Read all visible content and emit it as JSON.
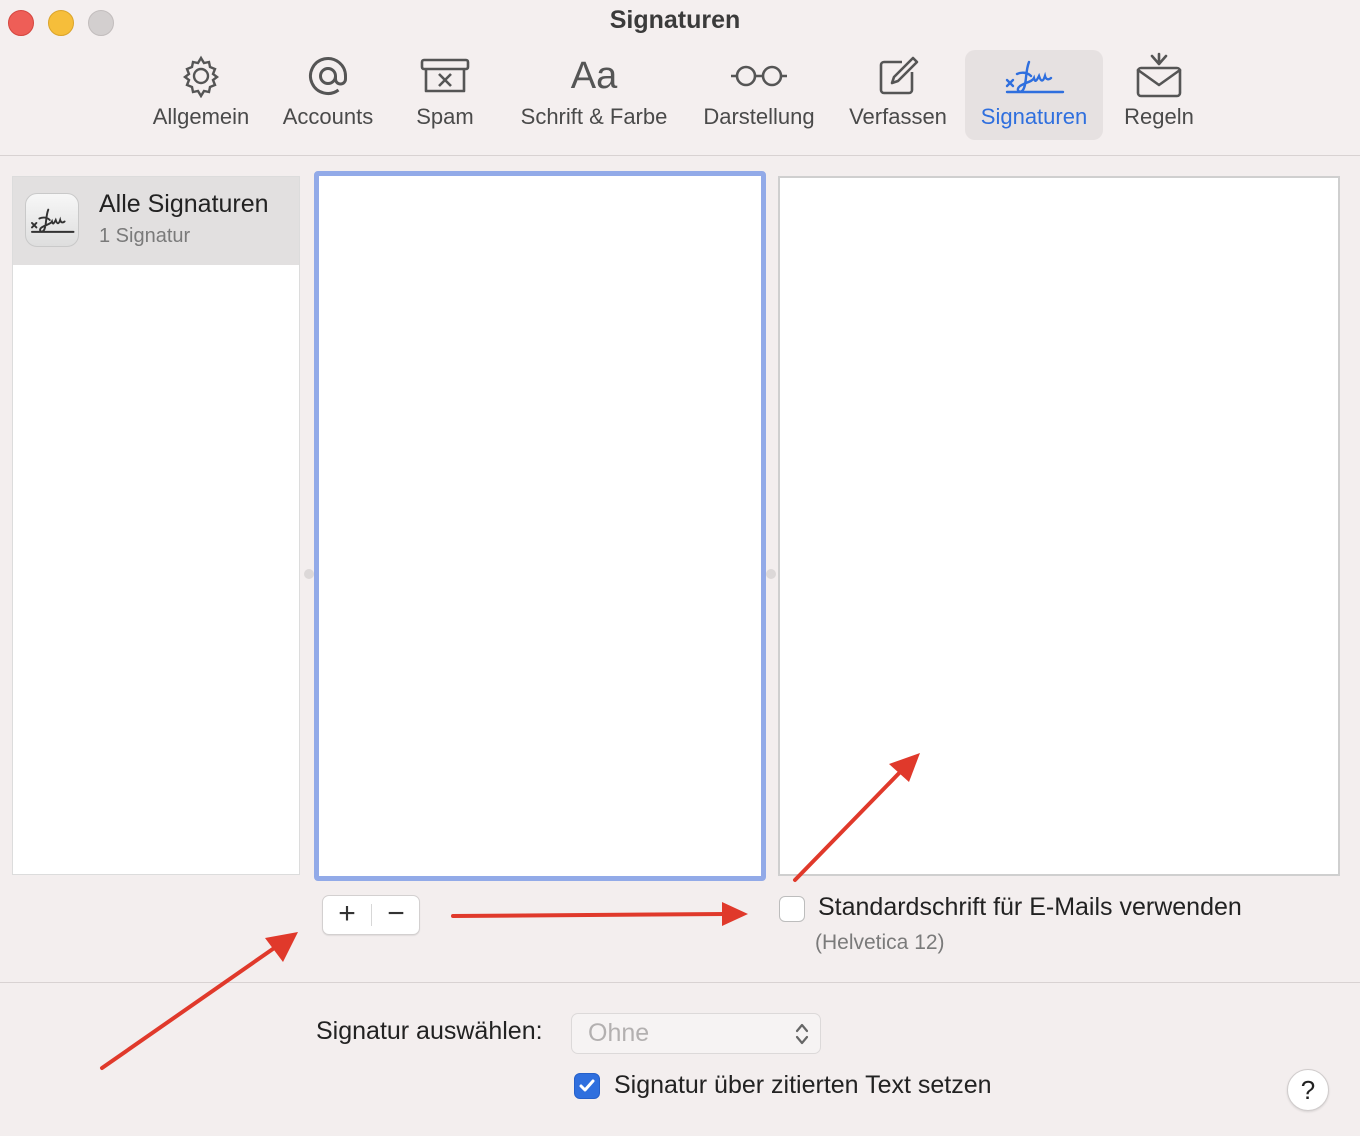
{
  "window": {
    "title": "Signaturen"
  },
  "toolbar": {
    "items": [
      {
        "label": "Allgemein",
        "icon": "gear-icon"
      },
      {
        "label": "Accounts",
        "icon": "at-icon"
      },
      {
        "label": "Spam",
        "icon": "junk-tray-icon"
      },
      {
        "label": "Schrift & Farbe",
        "icon": "font-icon"
      },
      {
        "label": "Darstellung",
        "icon": "glasses-icon"
      },
      {
        "label": "Verfassen",
        "icon": "compose-icon"
      },
      {
        "label": "Signaturen",
        "icon": "signature-icon",
        "active": true
      },
      {
        "label": "Regeln",
        "icon": "rules-envelope-icon"
      }
    ]
  },
  "accounts_list": {
    "items": [
      {
        "title": "Alle Signaturen",
        "subtitle": "1 Signatur"
      }
    ]
  },
  "signature_controls": {
    "add_label": "+",
    "remove_label": "−"
  },
  "options": {
    "default_font_label": "Standardschrift für E-Mails verwenden",
    "default_font_checked": false,
    "default_font_sub": "(Helvetica 12)",
    "select_signature_label": "Signatur auswählen:",
    "select_signature_value": "Ohne",
    "place_above_quote_label": "Signatur über zitierten Text setzen",
    "place_above_quote_checked": true
  },
  "help": {
    "label": "?"
  },
  "colors": {
    "accent": "#2f6fde",
    "annotation_arrow": "#e0392b",
    "selection_border": "#92aae8"
  }
}
